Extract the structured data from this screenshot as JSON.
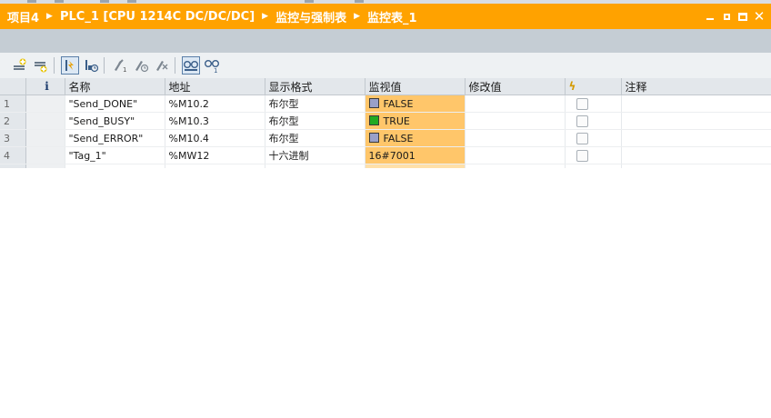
{
  "breadcrumb": [
    "项目4",
    "PLC_1 [CPU 1214C DC/DC/DC]",
    "监控与强制表",
    "监控表_1"
  ],
  "colors": {
    "accent": "#ffa200",
    "monitor_cell": "#ffc66a",
    "led_false": "#9aa0c8",
    "led_true": "#22aa22"
  },
  "toolbar": {
    "icons": [
      "insert-row-icon",
      "add-row-icon",
      "monitor-now-icon",
      "monitor-trigger-icon",
      "modify-once-icon",
      "modify-trigger-icon",
      "enable-peripheral-icon",
      "monitor-all-icon",
      "monitor-once-icon"
    ]
  },
  "table": {
    "headers": {
      "index": "",
      "info": "i",
      "name": "名称",
      "address": "地址",
      "format": "显示格式",
      "monitor": "监视值",
      "modify": "修改值",
      "force": "",
      "comment": "注释"
    },
    "rows": [
      {
        "index": "1",
        "name": "\"Send_DONE\"",
        "address": "%M10.2",
        "format": "布尔型",
        "monitor": "FALSE",
        "led": "false",
        "modify": "",
        "comment": ""
      },
      {
        "index": "2",
        "name": "\"Send_BUSY\"",
        "address": "%M10.3",
        "format": "布尔型",
        "monitor": "TRUE",
        "led": "true",
        "modify": "",
        "comment": ""
      },
      {
        "index": "3",
        "name": "\"Send_ERROR\"",
        "address": "%M10.4",
        "format": "布尔型",
        "monitor": "FALSE",
        "led": "false",
        "modify": "",
        "comment": ""
      },
      {
        "index": "4",
        "name": "\"Tag_1\"",
        "address": "%MW12",
        "format": "十六进制",
        "monitor": "16#7001",
        "led": "",
        "modify": "",
        "comment": ""
      }
    ]
  }
}
